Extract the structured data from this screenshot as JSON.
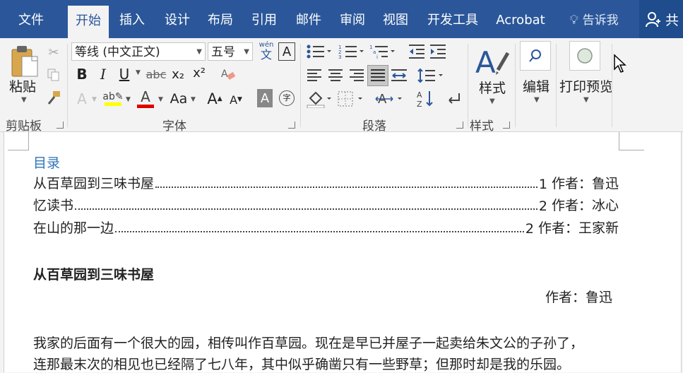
{
  "tabs": [
    {
      "label": "文件",
      "active": false
    },
    {
      "label": "开始",
      "active": true
    },
    {
      "label": "插入",
      "active": false
    },
    {
      "label": "设计",
      "active": false
    },
    {
      "label": "布局",
      "active": false
    },
    {
      "label": "引用",
      "active": false
    },
    {
      "label": "邮件",
      "active": false
    },
    {
      "label": "审阅",
      "active": false
    },
    {
      "label": "视图",
      "active": false
    },
    {
      "label": "开发工具",
      "active": false
    },
    {
      "label": "Acrobat",
      "active": false
    }
  ],
  "tell_me": "告诉我",
  "share_label": "共",
  "ribbon": {
    "clipboard": {
      "paste_label": "粘贴",
      "group_label": "剪贴板"
    },
    "font": {
      "font_name": "等线 (中文正文)",
      "font_size": "五号",
      "phonetic_top": "wén",
      "phonetic_bottom": "文",
      "group_label": "字体",
      "bold": "B",
      "italic": "I",
      "underline": "U",
      "strike": "abc",
      "subscript": "x₂",
      "superscript": "x²",
      "change_case": "Aa",
      "grow": "A",
      "shrink": "A",
      "char_shading": "A",
      "enclose": "字"
    },
    "paragraph": {
      "group_label": "段落"
    },
    "styles": {
      "label": "样式",
      "group_label": "样式"
    },
    "editing": {
      "label": "编辑"
    },
    "print_preview": {
      "label": "打印预览"
    }
  },
  "document": {
    "toc_title": "目录",
    "toc": [
      {
        "title": "从百草园到三味书屋",
        "page": "1",
        "author": "作者：鲁迅"
      },
      {
        "title": "忆读书",
        "page": "2",
        "author": "作者：冰心"
      },
      {
        "title": "在山的那一边",
        "page": "2",
        "author": "作者：王家新"
      }
    ],
    "heading": "从百草园到三味书屋",
    "author": "作者：鲁迅",
    "paragraph_line1": "我家的后面有一个很大的园，相传叫作百草园。现在是早已并屋子一起卖给朱文公的子孙了，",
    "paragraph_line2": "连那最末次的相见也已经隔了七八年，其中似乎确凿只有一些野草；但那时却是我的乐园。"
  },
  "colors": {
    "tab_bar": "#2b579a",
    "toc_title": "#2e74b5",
    "highlight": "#ffff00",
    "font_color": "#e00000"
  }
}
